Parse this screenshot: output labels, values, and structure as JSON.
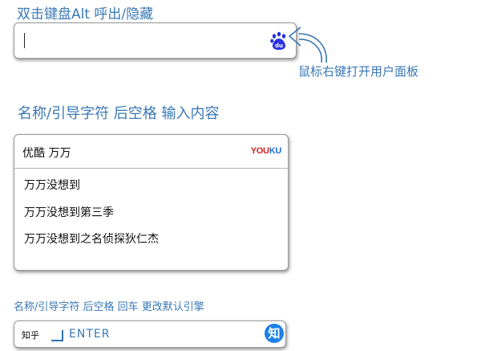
{
  "hints": {
    "top": "双击键盘Alt 呼出/隐藏",
    "right": "鼠标右键打开用户面板",
    "mid": "名称/引导字符 后空格 输入内容",
    "bottom": "名称/引导字符 后空格 回车 更改默认引擎"
  },
  "search_box": {
    "value": "",
    "engine_icon": "baidu-paw-icon"
  },
  "suggest_box": {
    "query": "优酷  万万",
    "logo": {
      "part1": "YOU",
      "part2": "KU"
    },
    "items": [
      "万万没想到",
      "万万没想到第三季",
      "万万没想到之名侦探狄仁杰"
    ]
  },
  "zhihu_box": {
    "label": "知乎",
    "enter_text": "ENTER",
    "icon_glyph": "知"
  },
  "colors": {
    "hint": "#3a78b5",
    "baidu_blue": "#2932e1",
    "youku_red": "#d61f1f",
    "youku_blue": "#1d6fd6",
    "zhihu_blue": "#1e80e6"
  }
}
